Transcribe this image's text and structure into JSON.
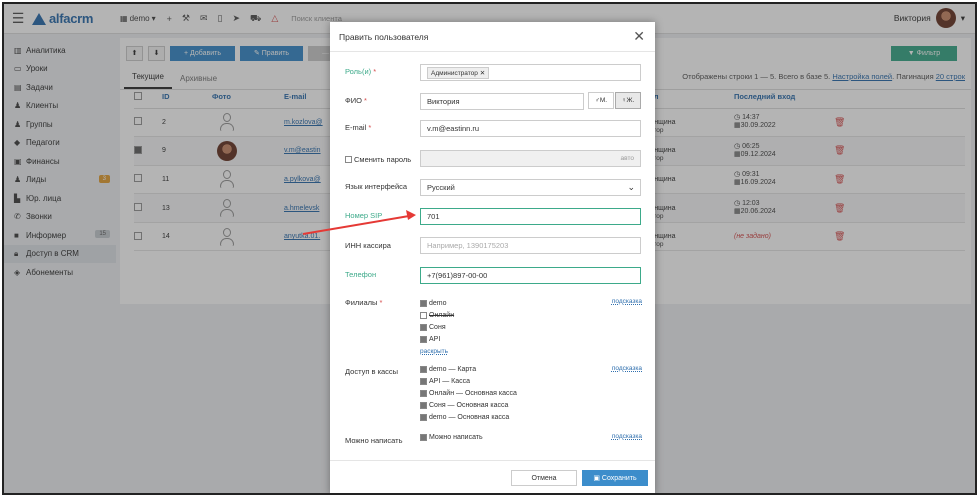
{
  "topbar": {
    "logo": "alfacrm",
    "branch": "demo",
    "search_placeholder": "Поиск клиента",
    "user_name": "Виктория"
  },
  "sidebar": {
    "items": [
      {
        "label": "Аналитика",
        "icon": "chart-icon"
      },
      {
        "label": "Уроки",
        "icon": "calendar-icon"
      },
      {
        "label": "Задачи",
        "icon": "tasks-icon"
      },
      {
        "label": "Клиенты",
        "icon": "user-icon"
      },
      {
        "label": "Группы",
        "icon": "group-icon"
      },
      {
        "label": "Педагоги",
        "icon": "graduation-icon"
      },
      {
        "label": "Финансы",
        "icon": "money-icon"
      },
      {
        "label": "Лиды",
        "icon": "leads-icon",
        "badge": "3"
      },
      {
        "label": "Юр. лица",
        "icon": "building-icon"
      },
      {
        "label": "Звонки",
        "icon": "phone-icon"
      },
      {
        "label": "Информер",
        "icon": "informer-icon",
        "badge": "15"
      },
      {
        "label": "Доступ в CRM",
        "icon": "lock-icon",
        "active": true
      },
      {
        "label": "Абонементы",
        "icon": "tag-icon"
      }
    ]
  },
  "main": {
    "toolbar": {
      "add": "+ Добавить",
      "edit": "✎ Править",
      "delete": "— Уд",
      "filter": "▼ Фильтр"
    },
    "tabs": [
      "Текущие",
      "Архивные"
    ],
    "stats_text": "Отображены строки 1 — 5. Всего в базе 5.",
    "stats_settings": "Настройка полей",
    "stats_pagination": "Пагинация",
    "stats_rows": "20 строк",
    "columns": [
      "ID",
      "Фото",
      "E-mail",
      "Пол",
      "Последний вход"
    ],
    "rows": [
      {
        "id": "2",
        "email": "m.kozlova@",
        "role_num": "9",
        "role": "стратор",
        "gender": "Женщина",
        "time": "14:37",
        "date": "30.09.2022",
        "photo": "placeholder"
      },
      {
        "id": "9",
        "email": "v.m@eastin",
        "role_num": "9",
        "role": "стратор",
        "gender": "Женщина",
        "time": "06:25",
        "date": "09.12.2024",
        "photo": "real",
        "checked": true
      },
      {
        "id": "11",
        "email": "a.pylkova@",
        "role_num": "9",
        "role": "тор",
        "gender": "Женщина",
        "time": "09:31",
        "date": "16.09.2024",
        "photo": "placeholder"
      },
      {
        "id": "13",
        "email": "a.hmelevsk",
        "role_num": "9",
        "role": "стратор",
        "gender": "Женщина",
        "time": "12:03",
        "date": "20.06.2024",
        "photo": "placeholder"
      },
      {
        "id": "14",
        "email": "anyutka.01.",
        "role_num": "9",
        "role": "стратор",
        "gender": "Женщина",
        "time": "",
        "date": "",
        "unset": "(не задано)",
        "photo": "placeholder"
      }
    ]
  },
  "modal": {
    "title": "Править пользователя",
    "roles_label": "Роль(и)",
    "roles_chip": "Администратор",
    "fio_label": "ФИО",
    "fio_value": "Виктория",
    "gender_m": "М.",
    "gender_f": "Ж.",
    "email_label": "E-mail",
    "email_value": "v.m@eastinn.ru",
    "password_label": "Сменить пароль",
    "password_auto": "авто",
    "lang_label": "Язык интерфейса",
    "lang_value": "Русский",
    "sip_label": "Номер SIP",
    "sip_value": "701",
    "inn_label": "ИНН кассира",
    "inn_placeholder": "Например, 1390175203",
    "phone_label": "Телефон",
    "phone_value": "+7(961)897-00-00",
    "branches_label": "Филиалы",
    "branches": [
      {
        "label": "demo",
        "checked": true
      },
      {
        "label": "Онлайн",
        "checked": false,
        "strike": true
      },
      {
        "label": "Соня",
        "checked": true
      },
      {
        "label": "API",
        "checked": true
      }
    ],
    "expand": "раскрыть",
    "hint": "подсказка",
    "cash_label": "Доступ в кассы",
    "cash": [
      "demo — Карта",
      "API — Касса",
      "Онлайн — Основная касса",
      "Соня — Основная касса",
      "demo — Основная касса"
    ],
    "write_label": "Можно написать",
    "write_value": "Можно написать",
    "cancel": "Отмена",
    "save": "Сохранить"
  },
  "colors": {
    "accent": "#3c8dcb",
    "green": "#3daa8a",
    "red": "#d54b4b",
    "arrow": "#e53935"
  }
}
